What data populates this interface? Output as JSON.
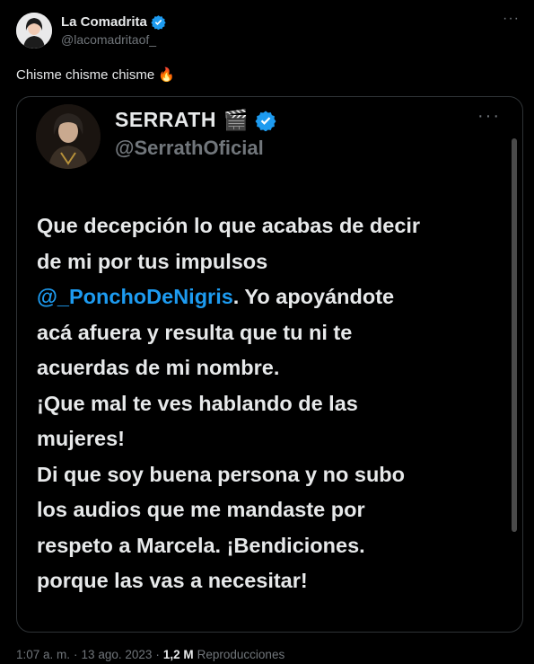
{
  "tweet": {
    "author_name": "La Comadrita",
    "author_handle": "@lacomadritaof_",
    "more_label": "···",
    "text": "Chisme chisme chisme",
    "text_emoji": "🔥"
  },
  "quoted": {
    "name": "SERRATH",
    "name_emoji": "🎬",
    "handle": "@SerrathOficial",
    "more_label": "···",
    "lines": {
      "l1": "Que decepción lo que acabas de decir",
      "l2": "de mi por tus impulsos",
      "l3_mention": "@_PonchoDeNigris",
      "l3_rest": ". Yo apoyándote",
      "l4": "acá afuera y resulta que tu ni te",
      "l5": "acuerdas de mi nombre.",
      "l6": "¡Que mal te ves hablando de las",
      "l7": "mujeres!",
      "l8": "Di que soy buena persona y no subo",
      "l9": "los audios que me mandaste por",
      "l10": "respeto a Marcela.  ¡Bendiciones.",
      "l11": "porque las vas a necesitar!"
    }
  },
  "footer": {
    "time": "1:07 a. m.",
    "sep1": "·",
    "date": "13 ago. 2023",
    "sep2": "·",
    "views_count": "1,2 M",
    "views_label": "Reproducciones"
  },
  "colors": {
    "background": "#000000",
    "text": "#e7e9ea",
    "secondary": "#71767b",
    "accent": "#1d9bf0"
  },
  "icons": {
    "verified": "verified-badge-icon",
    "more": "more-options-icon",
    "fire": "fire-emoji-icon",
    "clapper": "clapper-board-emoji-icon"
  }
}
